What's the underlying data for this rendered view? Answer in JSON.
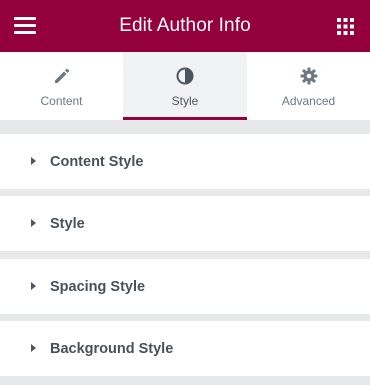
{
  "header": {
    "title": "Edit Author Info",
    "accent_color": "#93003c",
    "menu_icon": "hamburger-menu-icon",
    "apps_icon": "grid-apps-icon"
  },
  "tabs": [
    {
      "label": "Content",
      "icon": "pencil-icon",
      "active": false
    },
    {
      "label": "Style",
      "icon": "contrast-half-circle-icon",
      "active": true
    },
    {
      "label": "Advanced",
      "icon": "gear-icon",
      "active": false
    }
  ],
  "sections": [
    {
      "label": "Content Style",
      "icon": "caret-right-icon"
    },
    {
      "label": "Style",
      "icon": "caret-right-icon"
    },
    {
      "label": "Spacing Style",
      "icon": "caret-right-icon"
    },
    {
      "label": "Background Style",
      "icon": "caret-right-icon"
    }
  ]
}
